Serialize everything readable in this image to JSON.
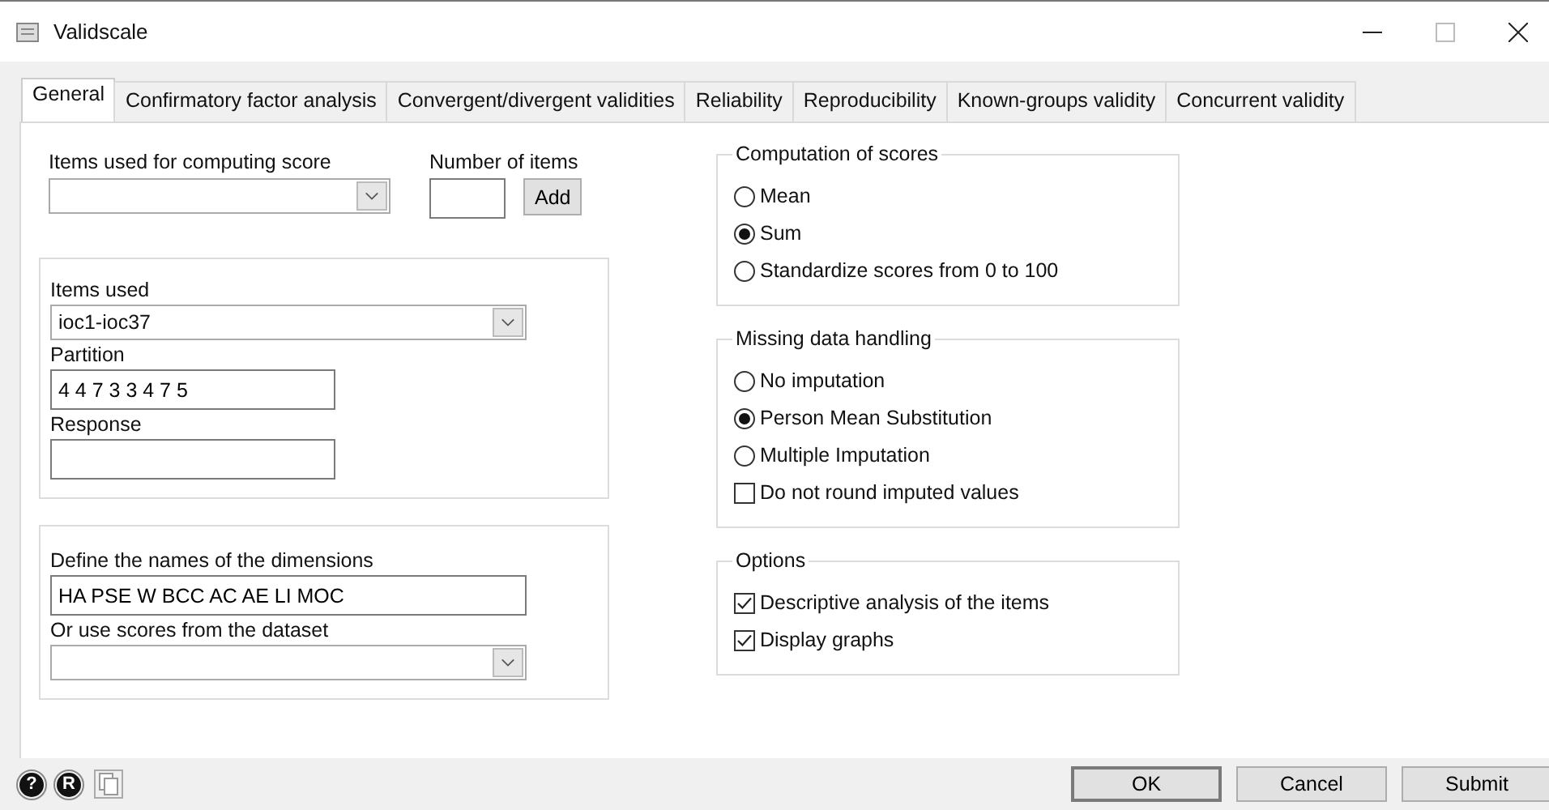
{
  "window": {
    "title": "Validscale"
  },
  "tabs": [
    {
      "label": "General",
      "selected": true
    },
    {
      "label": "Confirmatory factor analysis",
      "selected": false
    },
    {
      "label": "Convergent/divergent validities",
      "selected": false
    },
    {
      "label": "Reliability",
      "selected": false
    },
    {
      "label": "Reproducibility",
      "selected": false
    },
    {
      "label": "Known-groups validity",
      "selected": false
    },
    {
      "label": "Concurrent validity",
      "selected": false
    }
  ],
  "scoring": {
    "items_label": "Items used for computing score",
    "number_label": "Number of items",
    "add_button": "Add"
  },
  "items_group": {
    "items_used_label": "Items used",
    "items_used_value": "ioc1-ioc37",
    "partition_label": "Partition",
    "partition_value": "4 4 7 3 3 4 7 5",
    "response_label": "Response"
  },
  "dimensions_group": {
    "label": "Define the names of the dimensions",
    "value": "HA PSE W BCC AC AE LI MOC",
    "scores_label": "Or use scores from the dataset"
  },
  "computation": {
    "title": "Computation of scores",
    "options": [
      {
        "kind": "radio",
        "label": "Mean",
        "selected": false
      },
      {
        "kind": "radio",
        "label": "Sum",
        "selected": true
      },
      {
        "kind": "radio",
        "label": "Standardize scores from 0 to 100",
        "selected": false
      }
    ]
  },
  "missing": {
    "title": "Missing data handling",
    "options": [
      {
        "kind": "radio",
        "label": "No imputation",
        "selected": false
      },
      {
        "kind": "radio",
        "label": "Person Mean Substitution",
        "selected": true
      },
      {
        "kind": "radio",
        "label": "Multiple Imputation",
        "selected": false
      },
      {
        "kind": "checkbox",
        "label": "Do not round imputed values",
        "checked": false
      }
    ]
  },
  "options": {
    "title": "Options",
    "options": [
      {
        "kind": "checkbox",
        "label": "Descriptive analysis of the items",
        "checked": true
      },
      {
        "kind": "checkbox",
        "label": "Display graphs",
        "checked": true
      }
    ]
  },
  "footer": {
    "help_glyph": "?",
    "r_glyph": "R",
    "buttons": [
      "OK",
      "Cancel",
      "Submit"
    ]
  }
}
